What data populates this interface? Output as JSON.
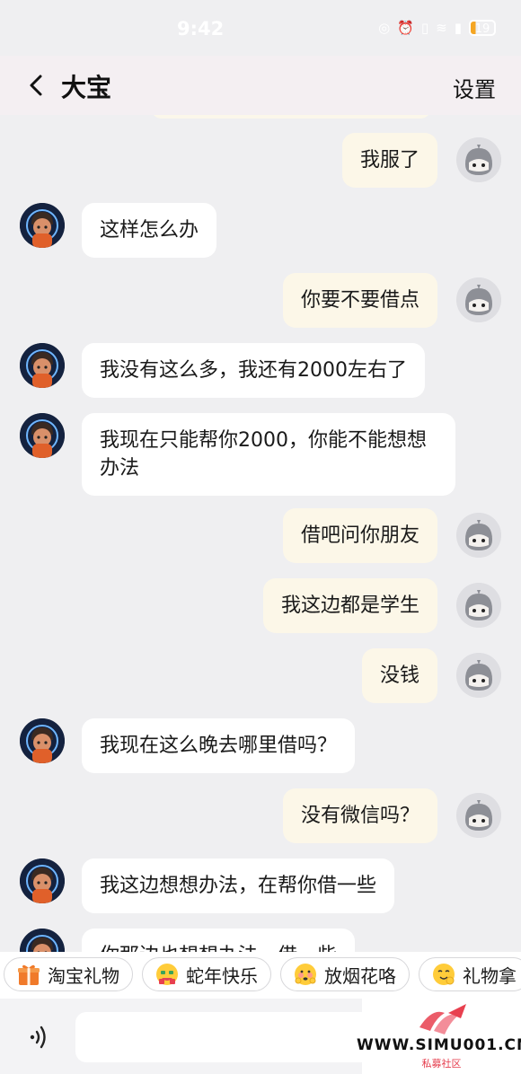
{
  "status_bar": {
    "time": "9:42",
    "battery": "19",
    "battery_color": "#f5a623"
  },
  "header": {
    "back_icon": "chevron-left-icon",
    "title": "大宝",
    "settings_label": "设置"
  },
  "messages": [
    {
      "side": "right",
      "text": "我服了"
    },
    {
      "side": "left",
      "text": "这样怎么办"
    },
    {
      "side": "right",
      "text": "你要不要借点"
    },
    {
      "side": "left",
      "text": "我没有这么多，我还有2000左右了"
    },
    {
      "side": "left",
      "text": "我现在只能帮你2000，你能不能想想办法"
    },
    {
      "side": "right",
      "text": "借吧问你朋友"
    },
    {
      "side": "right",
      "text": "我这边都是学生"
    },
    {
      "side": "right",
      "text": "没钱"
    },
    {
      "side": "left",
      "text": "我现在这么晚去哪里借吗？"
    },
    {
      "side": "right",
      "text": "没有微信吗？"
    },
    {
      "side": "left",
      "text": "我这边想想办法，在帮你借一些"
    },
    {
      "side": "left",
      "text": "你那边也想想办法，借一些"
    }
  ],
  "quick_replies": [
    {
      "icon": "gift-icon",
      "label": "淘宝礼物"
    },
    {
      "icon": "money-face-emoji-icon",
      "label": "蛇年快乐"
    },
    {
      "icon": "shy-face-emoji-icon",
      "label": "放烟花咯"
    },
    {
      "icon": "hug-face-emoji-icon",
      "label": "礼物拿"
    }
  ],
  "input": {
    "voice_icon": "voice-icon",
    "value": "",
    "placeholder": ""
  },
  "watermark": {
    "url": "WWW.SIMU001.CN",
    "subtitle": "私募社区"
  },
  "colors": {
    "background": "#efeff1",
    "header_bg": "#f4eff2",
    "bubble_left": "#ffffff",
    "bubble_right": "#fcf7e8",
    "accent_orange": "#f07a2a",
    "watermark_red": "#e53b4b"
  }
}
